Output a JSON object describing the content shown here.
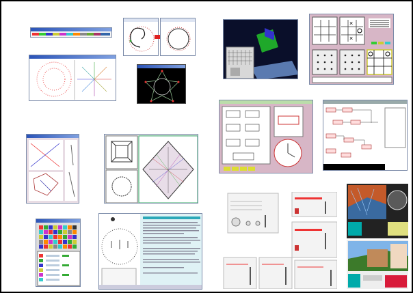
{
  "collage": {
    "background": "#ffffff",
    "border_color": "#000000"
  },
  "thumbnails": [
    {
      "id": "color-strip-window",
      "icon": "color-palette-icon"
    },
    {
      "id": "circle-spiral-left",
      "icon": "circle-icon"
    },
    {
      "id": "transform-arrow",
      "icon": "arrow-right-icon"
    },
    {
      "id": "circle-spiral-right",
      "icon": "circle-icon"
    },
    {
      "id": "radial-dots-window",
      "icon": "radial-icon"
    },
    {
      "id": "star-graph-black",
      "icon": "star-icon"
    },
    {
      "id": "3d-grid-window",
      "icon": "grid-icon"
    },
    {
      "id": "tic-tac-toe-window",
      "icon": "grid-icon"
    },
    {
      "id": "cross-diagram-window",
      "icon": "cross-icon"
    },
    {
      "id": "lattice-diamond-window",
      "icon": "diamond-icon"
    },
    {
      "id": "clock-flow-window",
      "icon": "clock-icon"
    },
    {
      "id": "node-flow-window",
      "icon": "flowchart-icon"
    },
    {
      "id": "color-swatch-grid",
      "icon": "swatch-icon"
    },
    {
      "id": "hand-drawn-article",
      "icon": "document-icon"
    },
    {
      "id": "slider-panels",
      "icon": "slider-icon"
    },
    {
      "id": "3d-scene-windows",
      "icon": "landscape-icon"
    }
  ],
  "colors": {
    "win_blue": "#2b54b8",
    "red_arrow": "#e02020",
    "green_plane": "#1fa82a",
    "pink_panel": "#d7b6c6",
    "teal": "#2aa8b8"
  }
}
